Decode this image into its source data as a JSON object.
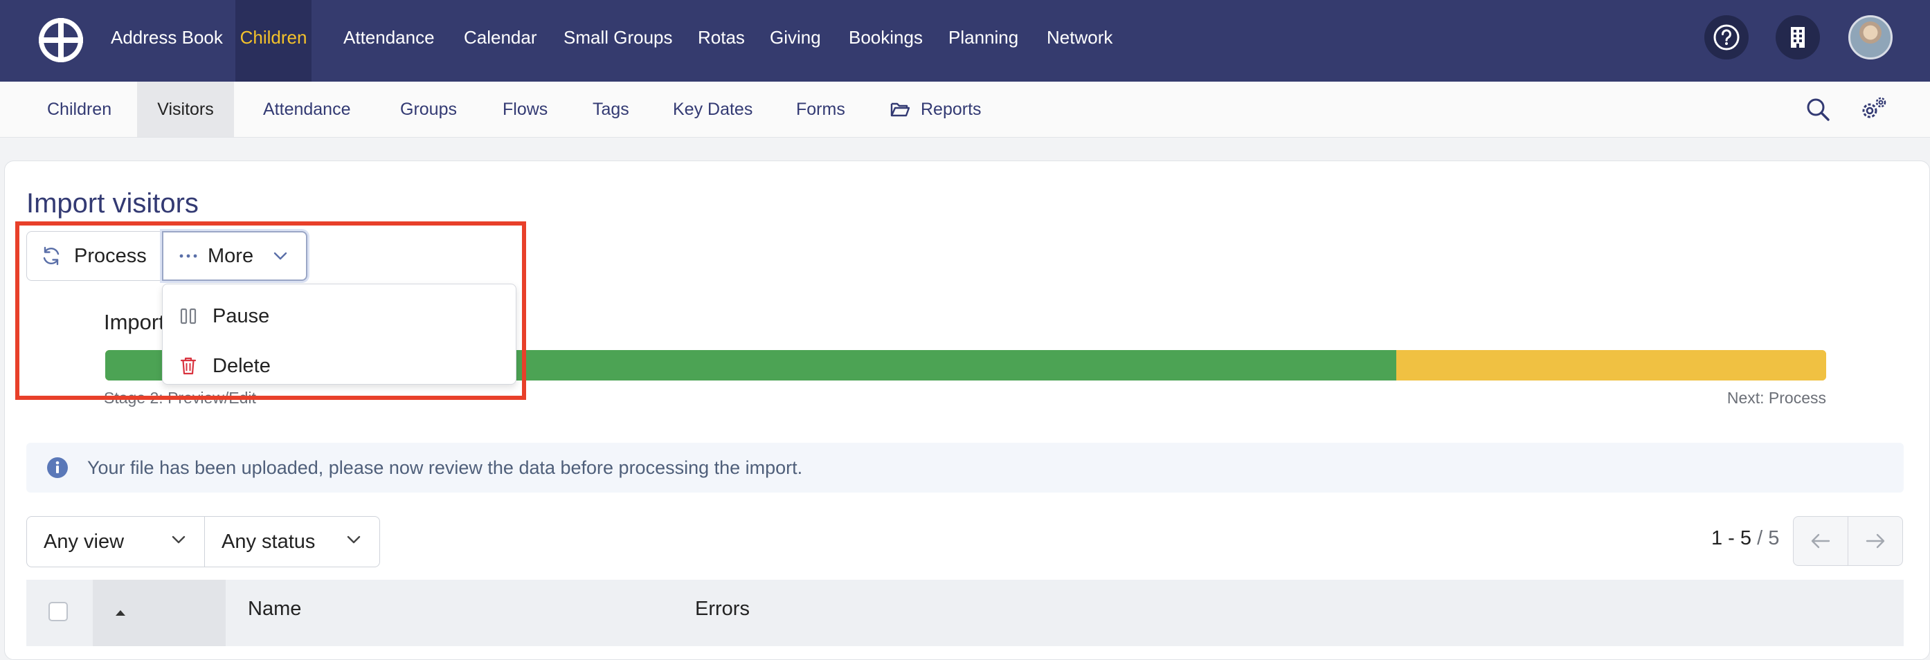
{
  "topnav": {
    "items": [
      {
        "label": "Address Book",
        "active": false
      },
      {
        "label": "Children",
        "active": true
      },
      {
        "label": "Attendance",
        "active": false
      },
      {
        "label": "Calendar",
        "active": false
      },
      {
        "label": "Small Groups",
        "active": false
      },
      {
        "label": "Rotas",
        "active": false
      },
      {
        "label": "Giving",
        "active": false
      },
      {
        "label": "Bookings",
        "active": false
      },
      {
        "label": "Planning",
        "active": false
      },
      {
        "label": "Network",
        "active": false
      }
    ],
    "icons": [
      "logo-icon",
      "help-icon",
      "building-icon",
      "avatar"
    ]
  },
  "subnav": {
    "items": [
      {
        "label": "Children",
        "active": false
      },
      {
        "label": "Visitors",
        "active": true
      },
      {
        "label": "Attendance",
        "active": false
      },
      {
        "label": "Groups",
        "active": false
      },
      {
        "label": "Flows",
        "active": false
      },
      {
        "label": "Tags",
        "active": false
      },
      {
        "label": "Key Dates",
        "active": false
      },
      {
        "label": "Forms",
        "active": false
      },
      {
        "label": "Reports",
        "active": false
      }
    ]
  },
  "page": {
    "title": "Import visitors",
    "process_label": "Process",
    "more_label": "More",
    "menu": {
      "pause_label": "Pause",
      "delete_label": "Delete"
    },
    "import_label": "Import",
    "progress_fraction": 0.75,
    "stage_label": "Stage 2: Preview/Edit",
    "next_label": "Next: Process",
    "info_message": "Your file has been uploaded, please now review the data before processing the import.",
    "filters": {
      "view": "Any view",
      "status": "Any status"
    },
    "pager": {
      "range": "1 - 5",
      "separator": " / ",
      "total": "5"
    },
    "table": {
      "columns": [
        "Name",
        "Errors"
      ]
    }
  },
  "colors": {
    "nav_bg": "#353b6e",
    "accent": "#f4c22b",
    "progress_done": "#4ca354",
    "progress_pending": "#f0c142",
    "highlight": "#e8402a"
  }
}
